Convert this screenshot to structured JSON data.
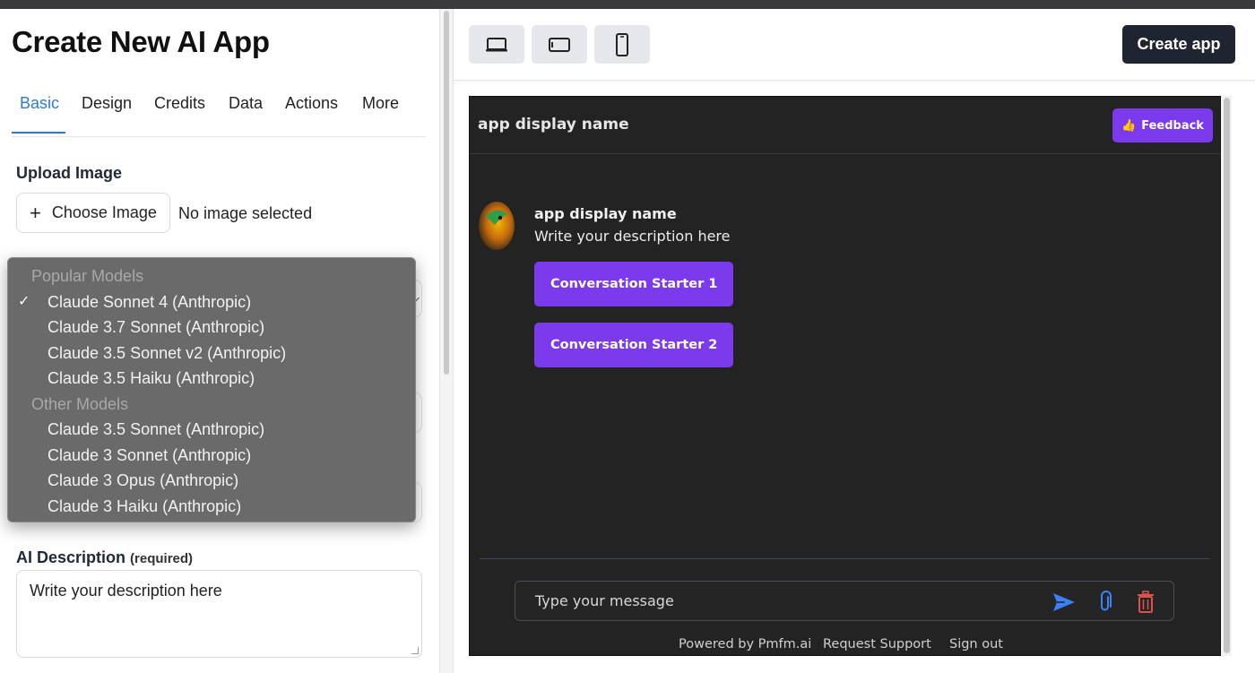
{
  "page": {
    "title": "Create New AI App"
  },
  "tabs": [
    {
      "label": "Basic",
      "active": true
    },
    {
      "label": "Design",
      "active": false
    },
    {
      "label": "Credits",
      "active": false
    },
    {
      "label": "Data",
      "active": false
    },
    {
      "label": "Actions",
      "active": false
    },
    {
      "label": "More",
      "active": false
    }
  ],
  "upload": {
    "label": "Upload Image",
    "button_label": "Choose Image",
    "status": "No image selected"
  },
  "model_dropdown": {
    "groups": [
      {
        "label": "Popular Models",
        "options": [
          {
            "label": "Claude Sonnet 4 (Anthropic)",
            "selected": true
          },
          {
            "label": "Claude 3.7 Sonnet (Anthropic)",
            "selected": false
          },
          {
            "label": "Claude 3.5 Sonnet v2 (Anthropic)",
            "selected": false
          },
          {
            "label": "Claude 3.5 Haiku (Anthropic)",
            "selected": false
          }
        ]
      },
      {
        "label": "Other Models",
        "options": [
          {
            "label": "Claude 3.5 Sonnet (Anthropic)",
            "selected": false
          },
          {
            "label": "Claude 3 Sonnet (Anthropic)",
            "selected": false
          },
          {
            "label": "Claude 3 Opus (Anthropic)",
            "selected": false
          },
          {
            "label": "Claude 3 Haiku (Anthropic)",
            "selected": false
          }
        ]
      }
    ],
    "check_mark": "✓"
  },
  "ai_description": {
    "label": "AI Description",
    "required_note": "(required)",
    "value": "Write your description here"
  },
  "toolbar": {
    "devices": [
      "laptop-icon",
      "tablet-landscape-icon",
      "phone-icon"
    ],
    "create_label": "Create app"
  },
  "preview": {
    "app_name": "app display name",
    "feedback_label": "Feedback",
    "feedback_emoji": "👍",
    "bot_name": "app display name",
    "bot_description": "Write your description here",
    "starters": [
      "Conversation Starter 1",
      "Conversation Starter 2"
    ],
    "message_placeholder": "Type your message",
    "footer": {
      "powered_by": "Powered by Pmfm.ai",
      "support": "Request Support",
      "sign_out": "Sign out"
    }
  },
  "colors": {
    "accent_blue": "#2b7bd6",
    "purple": "#7c3aed",
    "dark_button": "#1e2430",
    "preview_bg": "#232323",
    "send_icon": "#3b82f6",
    "trash_icon": "#d9534f"
  }
}
